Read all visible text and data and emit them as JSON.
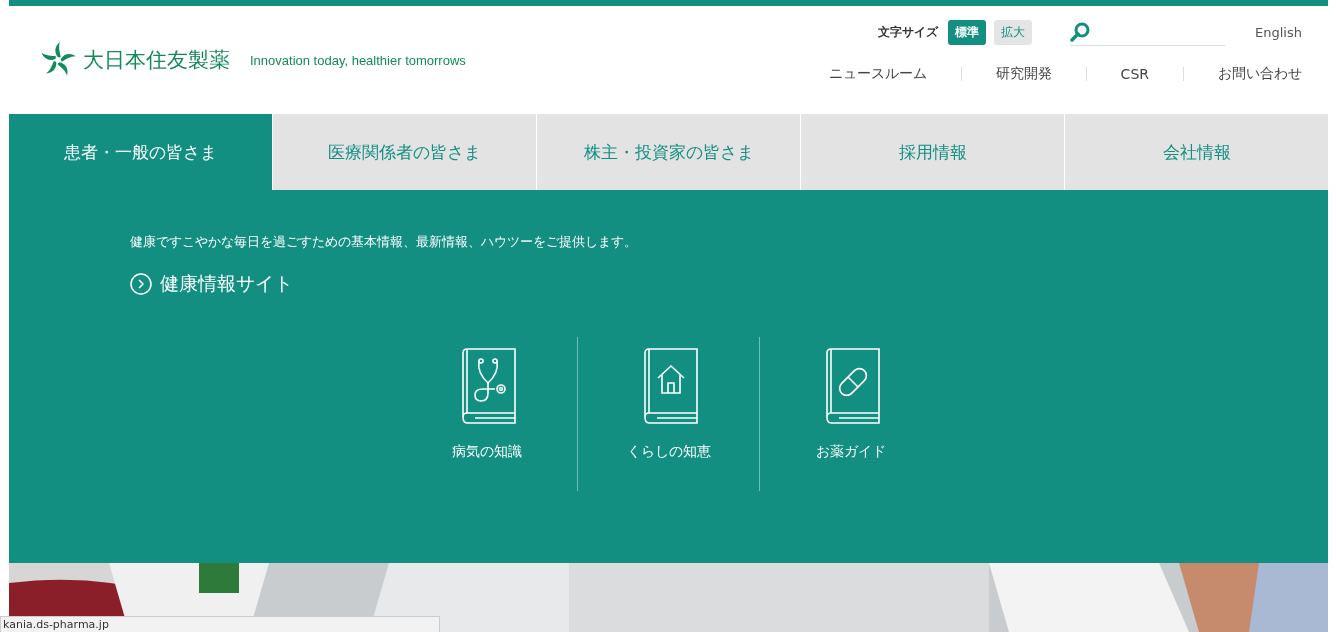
{
  "header": {
    "logo_text": "大日本住友製薬",
    "tagline": "Innovation today, healthier tomorrows",
    "font_size": {
      "label": "文字サイズ",
      "options": [
        {
          "label": "標準",
          "selected": true
        },
        {
          "label": "拡大",
          "selected": false
        }
      ]
    },
    "language_link": "English",
    "utility_links": [
      "ニュースルーム",
      "研究開発",
      "CSR",
      "お問い合わせ"
    ]
  },
  "tabs": [
    {
      "label": "患者・一般の皆さま",
      "selected": true
    },
    {
      "label": "医療関係者の皆さま",
      "selected": false
    },
    {
      "label": "株主・投資家の皆さま",
      "selected": false
    },
    {
      "label": "採用情報",
      "selected": false
    },
    {
      "label": "会社情報",
      "selected": false
    }
  ],
  "mega_menu": {
    "description": "健康ですこやかな毎日を過ごすための基本情報、最新情報、ハウツーをご提供します。",
    "site_link": "健康情報サイト",
    "items": [
      {
        "label": "病気の知識",
        "kind": "stethoscope"
      },
      {
        "label": "くらしの知恵",
        "kind": "house"
      },
      {
        "label": "お薬ガイド",
        "kind": "pill"
      }
    ]
  },
  "status_url": "kania.ds-pharma.jp"
}
